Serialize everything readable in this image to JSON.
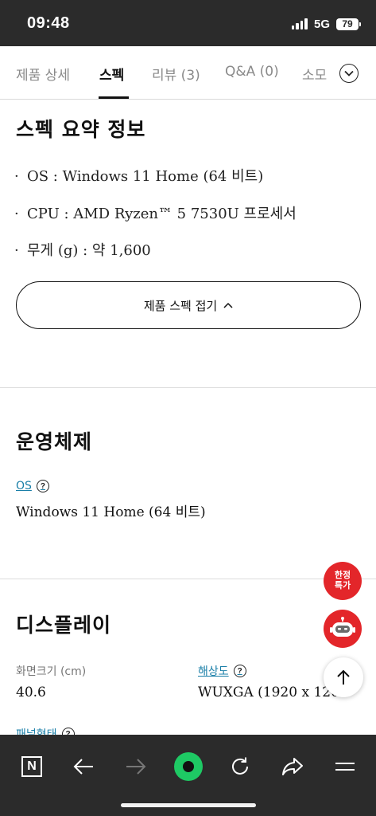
{
  "status_bar": {
    "time": "09:48",
    "network": "5G",
    "battery": "79"
  },
  "tabs": [
    {
      "label": "제품 상세"
    },
    {
      "label": "스펙"
    },
    {
      "label": "리뷰 (3)"
    },
    {
      "label": "Q&A (0)"
    },
    {
      "label": "소모"
    }
  ],
  "active_tab": "스펙",
  "summary": {
    "title": "스펙 요약 정보",
    "items": [
      "OS : Windows 11 Home (64 비트)",
      "CPU : AMD Ryzen™ 5 7530U 프로세서",
      "무게 (g) : 약 1,600"
    ],
    "bullet": "·",
    "collapse_label": "제품 스펙 접기"
  },
  "os_section": {
    "title": "운영체제",
    "label": "OS",
    "value": "Windows 11 Home (64 비트)"
  },
  "display_section": {
    "title": "디스플레이",
    "size_label": "화면크기 (cm)",
    "size_value": "40.6",
    "resolution_label": "해상도",
    "resolution_value": "WUXGA (1920 x 1200)",
    "panel_label": "패널형태"
  },
  "help_glyph": "?",
  "floating": {
    "deal_label_line1": "한정",
    "deal_label_line2": "특가"
  },
  "toolbar": {
    "home_label": "N"
  },
  "colors": {
    "accent_red": "#e3262a",
    "link_blue": "#1a7fa8",
    "status_green": "#1ec964",
    "chrome_dark": "#2b2b2b"
  }
}
